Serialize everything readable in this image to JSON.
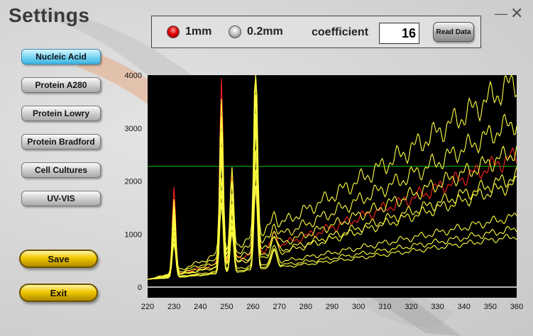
{
  "window": {
    "title": "Settings",
    "minimize_glyph": "—",
    "close_glyph": "✕"
  },
  "topbar": {
    "option_1mm": "1mm",
    "option_02mm": "0.2mm",
    "selected": "1mm",
    "coefficient_label": "coefficient",
    "coefficient_value": "16",
    "read_data_label": "Read Data"
  },
  "menu": {
    "items": [
      {
        "label": "Nucleic Acid",
        "active": true
      },
      {
        "label": "Protein A280",
        "active": false
      },
      {
        "label": "Protein Lowry",
        "active": false
      },
      {
        "label": "Protein Bradford",
        "active": false
      },
      {
        "label": "Cell Cultures",
        "active": false
      },
      {
        "label": "UV-VIS",
        "active": false
      }
    ],
    "save_label": "Save",
    "exit_label": "Exit"
  },
  "colors": {
    "active_menu": "#5cc8f0",
    "radio_selected": "#e00000",
    "gold_button": "#f2c800",
    "plot_background": "#000000",
    "threshold_line": "#00c000",
    "baseline": "#f0f0f0",
    "red_series": "#ff2020",
    "yellow_series": "#ffff40"
  },
  "chart_data": {
    "type": "line",
    "title": "",
    "xlabel": "",
    "ylabel": "",
    "xlim": [
      220,
      360
    ],
    "ylim": [
      -200,
      4000
    ],
    "x_ticks": [
      220,
      230,
      240,
      250,
      260,
      270,
      280,
      290,
      300,
      310,
      320,
      330,
      340,
      350,
      360
    ],
    "y_ticks": [
      0,
      1000,
      2000,
      3000,
      4000
    ],
    "grid": false,
    "threshold_y": 2280,
    "baseline_y": 0,
    "peaks": [
      230,
      248,
      252,
      261
    ],
    "series": [
      {
        "color": "red",
        "baseline_scale": 2450,
        "peak_heights": [
          1650,
          3500,
          1600,
          3750
        ]
      },
      {
        "color": "yellow",
        "baseline_scale": 3950,
        "peak_heights": [
          1350,
          2950,
          1450,
          3700
        ]
      },
      {
        "color": "yellow",
        "baseline_scale": 3150,
        "peak_heights": [
          1250,
          2700,
          1350,
          3350
        ]
      },
      {
        "color": "yellow",
        "baseline_scale": 2550,
        "peak_heights": [
          1150,
          2450,
          1250,
          3000
        ]
      },
      {
        "color": "yellow",
        "baseline_scale": 2050,
        "peak_heights": [
          1050,
          2200,
          1150,
          2700
        ]
      },
      {
        "color": "yellow",
        "baseline_scale": 1900,
        "peak_heights": [
          950,
          2000,
          1050,
          2450
        ]
      },
      {
        "color": "yellow",
        "baseline_scale": 1250,
        "peak_heights": [
          850,
          1750,
          950,
          2150
        ]
      },
      {
        "color": "yellow",
        "baseline_scale": 1000,
        "peak_heights": [
          750,
          1550,
          850,
          1850
        ]
      },
      {
        "color": "yellow",
        "baseline_scale": 850,
        "peak_heights": [
          650,
          1350,
          750,
          1600
        ]
      }
    ]
  }
}
